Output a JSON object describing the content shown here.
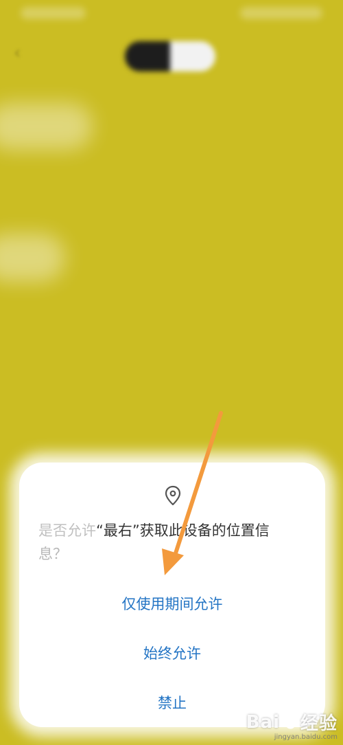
{
  "dialog": {
    "icon": "location-pin-icon",
    "message_part1": "是否允许",
    "message_part2": "“最右”获取此设备的位置信",
    "message_part3": "息？",
    "actions": {
      "while_using": "仅使用期间允许",
      "always": "始终允许",
      "deny": "禁止"
    }
  },
  "annotation": {
    "color": "#f39a3d"
  },
  "watermark": {
    "brand_left": "Bai",
    "brand_right": "经验",
    "domain": "jingyan.baidu.com"
  },
  "colors": {
    "background": "#cbbd23",
    "action_text": "#2374c4"
  }
}
